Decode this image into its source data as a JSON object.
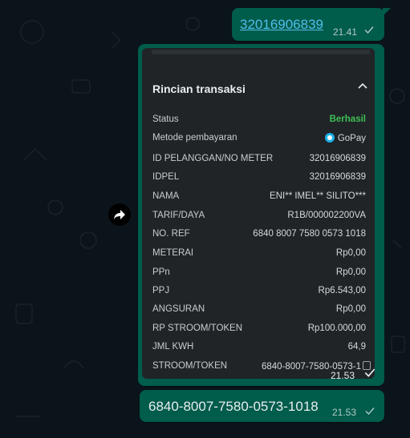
{
  "messages": [
    {
      "text": "32016906839",
      "time": "21.41"
    },
    {
      "receipt": {
        "title": "Rincian transaksi",
        "rows": [
          {
            "key": "Status",
            "value": "Berhasil"
          },
          {
            "key": "Metode pembayaran",
            "value": "GoPay"
          },
          {
            "key": "ID PELANGGAN/NO METER",
            "value": "32016906839"
          },
          {
            "key": "IDPEL",
            "value": "32016906839"
          },
          {
            "key": "NAMA",
            "value": "ENI** IMEL** SILITO***"
          },
          {
            "key": "TARIF/DAYA",
            "value": "R1B/000002200VA"
          },
          {
            "key": "NO. REF",
            "value": "6840 8007 7580 0573 1018"
          },
          {
            "key": "METERAI",
            "value": "Rp0,00"
          },
          {
            "key": "PPn",
            "value": "Rp0,00"
          },
          {
            "key": "PPJ",
            "value": "Rp6.543,00"
          },
          {
            "key": "ANGSURAN",
            "value": "Rp0,00"
          },
          {
            "key": "RP STROOM/TOKEN",
            "value": "Rp100.000,00"
          },
          {
            "key": "JML KWH",
            "value": "64,9"
          },
          {
            "key": "STROOM/TOKEN",
            "value": "6840-8007-7580-0573-1"
          }
        ]
      },
      "time": "21.53"
    },
    {
      "text": "6840-8007-7580-0573-1018",
      "time": "21.53"
    }
  ],
  "icons": {
    "check": "checkmark-icon",
    "forward": "forward-arrow-icon",
    "chevron": "chevron-up-icon",
    "copy": "copy-icon",
    "gopay": "gopay-logo-icon"
  },
  "colors": {
    "background": "#0b141a",
    "bubble": "#005c4b",
    "receipt_bg": "#202427",
    "success": "#3fbf55",
    "link": "#53bdeb"
  }
}
